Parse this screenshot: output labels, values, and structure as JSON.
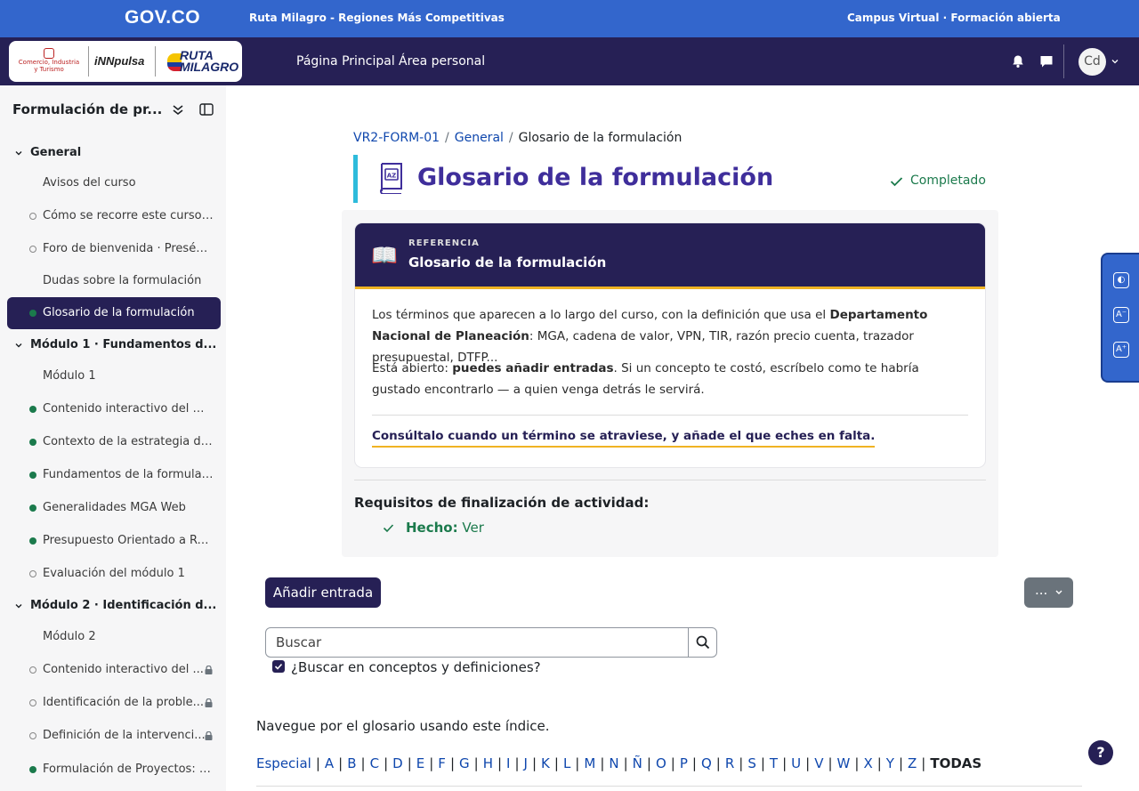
{
  "govbar": {
    "logo": "GOV.CO",
    "subtitle": "Ruta Milagro - Regiones Más Competitivas",
    "right": "Campus Virtual · Formación abierta"
  },
  "navbar": {
    "logos": {
      "ministry": "Comercio, Industria y Turismo",
      "innpulsa": "iNNpulsa",
      "ruta": "RUTA MILAGRO"
    },
    "links": [
      "Página Principal",
      "Área personal"
    ],
    "avatar_initials": "Cd",
    "icons": [
      "bell-icon",
      "chat-icon",
      "chevron-down-icon"
    ]
  },
  "sidebar": {
    "title": "Formulación de pr...",
    "items": [
      {
        "label": "General",
        "kind": "section"
      },
      {
        "label": "Avisos del curso",
        "kind": "plain"
      },
      {
        "label": "Cómo se recorre este curso ...",
        "kind": "todo"
      },
      {
        "label": "Foro de bienvenida · Presént...",
        "kind": "todo"
      },
      {
        "label": "Dudas sobre la formulación",
        "kind": "plain"
      },
      {
        "label": "Glosario de la formulación",
        "kind": "done",
        "active": true
      },
      {
        "label": "Módulo 1 · Fundamentos d...",
        "kind": "section"
      },
      {
        "label": "Módulo 1",
        "kind": "plain"
      },
      {
        "label": "Contenido interactivo del mó...",
        "kind": "done"
      },
      {
        "label": "Contexto de la estrategia de...",
        "kind": "done"
      },
      {
        "label": "Fundamentos de la formulac...",
        "kind": "done"
      },
      {
        "label": "Generalidades MGA Web",
        "kind": "done"
      },
      {
        "label": "Presupuesto Orientado a Res...",
        "kind": "done"
      },
      {
        "label": "Evaluación del módulo 1",
        "kind": "todo"
      },
      {
        "label": "Módulo 2 · Identificación d...",
        "kind": "section"
      },
      {
        "label": "Módulo 2",
        "kind": "plain"
      },
      {
        "label": "Contenido interactivo del ...",
        "kind": "todo",
        "locked": true
      },
      {
        "label": "Identificación de la proble...",
        "kind": "todo",
        "locked": true
      },
      {
        "label": "Definición de la intervenci...",
        "kind": "todo",
        "locked": true
      },
      {
        "label": "Formulación de Proyectos: I...",
        "kind": "done"
      }
    ]
  },
  "breadcrumb": {
    "items": [
      "VR2-FORM-01",
      "General"
    ],
    "current": "Glosario de la formulación"
  },
  "page": {
    "title": "Glosario de la formulación",
    "status": "Completado"
  },
  "card": {
    "kicker": "REFERENCIA",
    "title": "Glosario de la formulación",
    "p1_a": "Los términos que aparecen a lo largo del curso, con la definición que usa el ",
    "p1_b": "Departamento Nacional de Planeación",
    "p1_c": ": MGA, cadena de valor, VPN, TIR, razón precio cuenta, trazador presupuestal, DTFP...",
    "p2_a": "Está abierto: ",
    "p2_b": "puedes añadir entradas",
    "p2_c": ". Si un concepto te costó, escríbelo como te habría gustado encontrarlo — a quien venga detrás le servirá.",
    "cta": "Consúltalo cuando un término se atraviese, y añade el que eches en falta."
  },
  "requirements": {
    "title": "Requisitos de finalización de actividad:",
    "item_label": "Hecho:",
    "item_value": "Ver"
  },
  "actions": {
    "add_entry": "Añadir entrada",
    "more": "..."
  },
  "search": {
    "placeholder": "Buscar",
    "checkbox_label": "¿Buscar en conceptos y definiciones?",
    "checked": true
  },
  "browse": {
    "text": "Navegue por el glosario usando este índice.",
    "letters": [
      "Especial",
      "A",
      "B",
      "C",
      "D",
      "E",
      "F",
      "G",
      "H",
      "I",
      "J",
      "K",
      "L",
      "M",
      "N",
      "Ñ",
      "O",
      "P",
      "Q",
      "R",
      "S",
      "T",
      "U",
      "V",
      "W",
      "X",
      "Y",
      "Z"
    ],
    "all": "TODAS"
  },
  "help": "?",
  "colors": {
    "brand": "#262055",
    "gov": "#3366cc",
    "accent": "#f0b323",
    "success": "#1b7a4c",
    "link": "#0f47ad",
    "title": "#3f2e9b"
  }
}
